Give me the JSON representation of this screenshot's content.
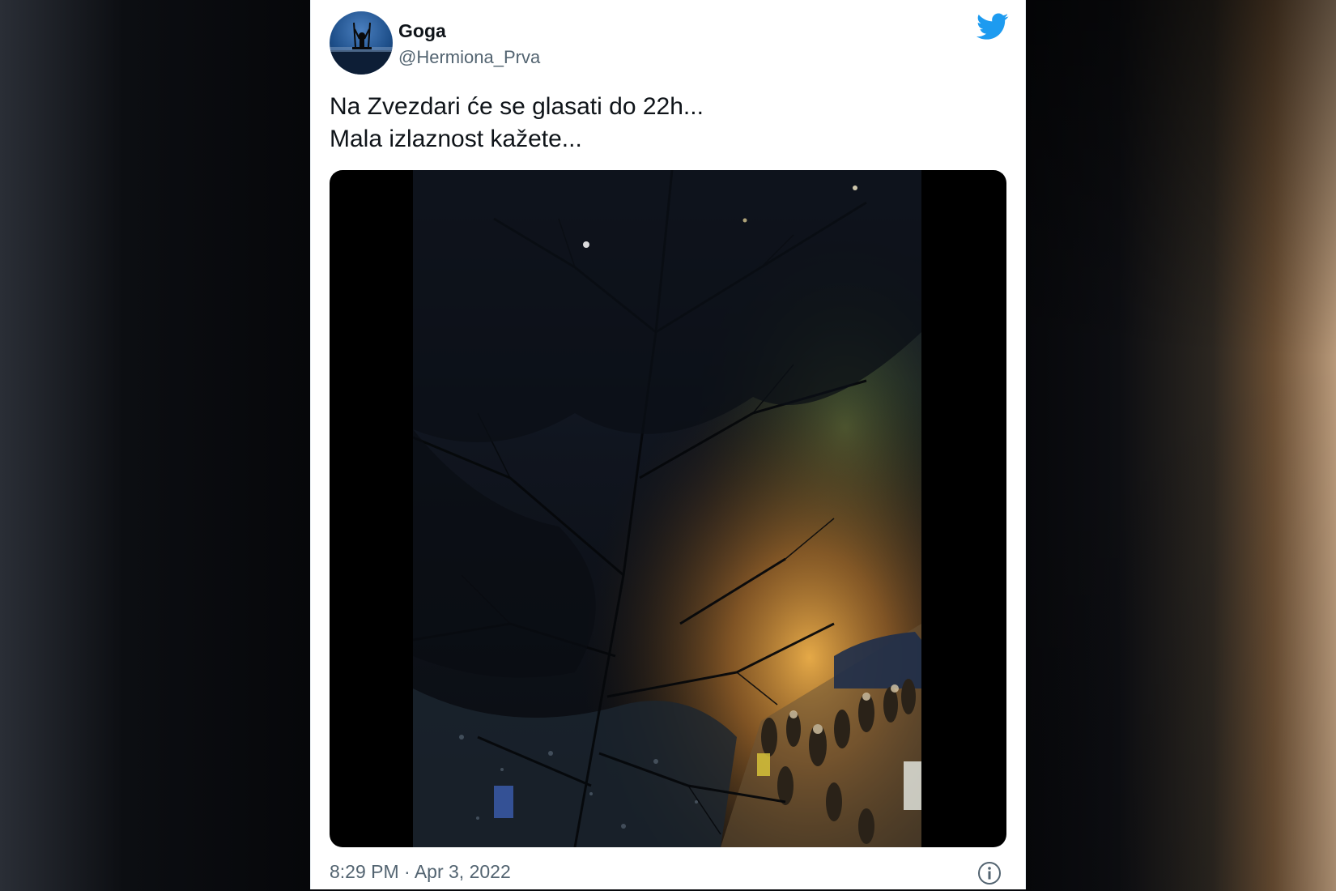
{
  "tweet": {
    "author_name": "Goga",
    "author_handle": "@Hermiona_Prva",
    "text_lines": [
      "Na Zvezdari će se glasati do 22h...",
      "Mala izlaznost kažete..."
    ],
    "timestamp": "8:29 PM · Apr 3, 2022"
  },
  "icons": {
    "brand": "twitter-bird-icon",
    "info": "info-icon"
  },
  "colors": {
    "twitter_blue": "#1d9bf0",
    "text_primary": "#0f1419",
    "text_secondary": "#536471"
  }
}
